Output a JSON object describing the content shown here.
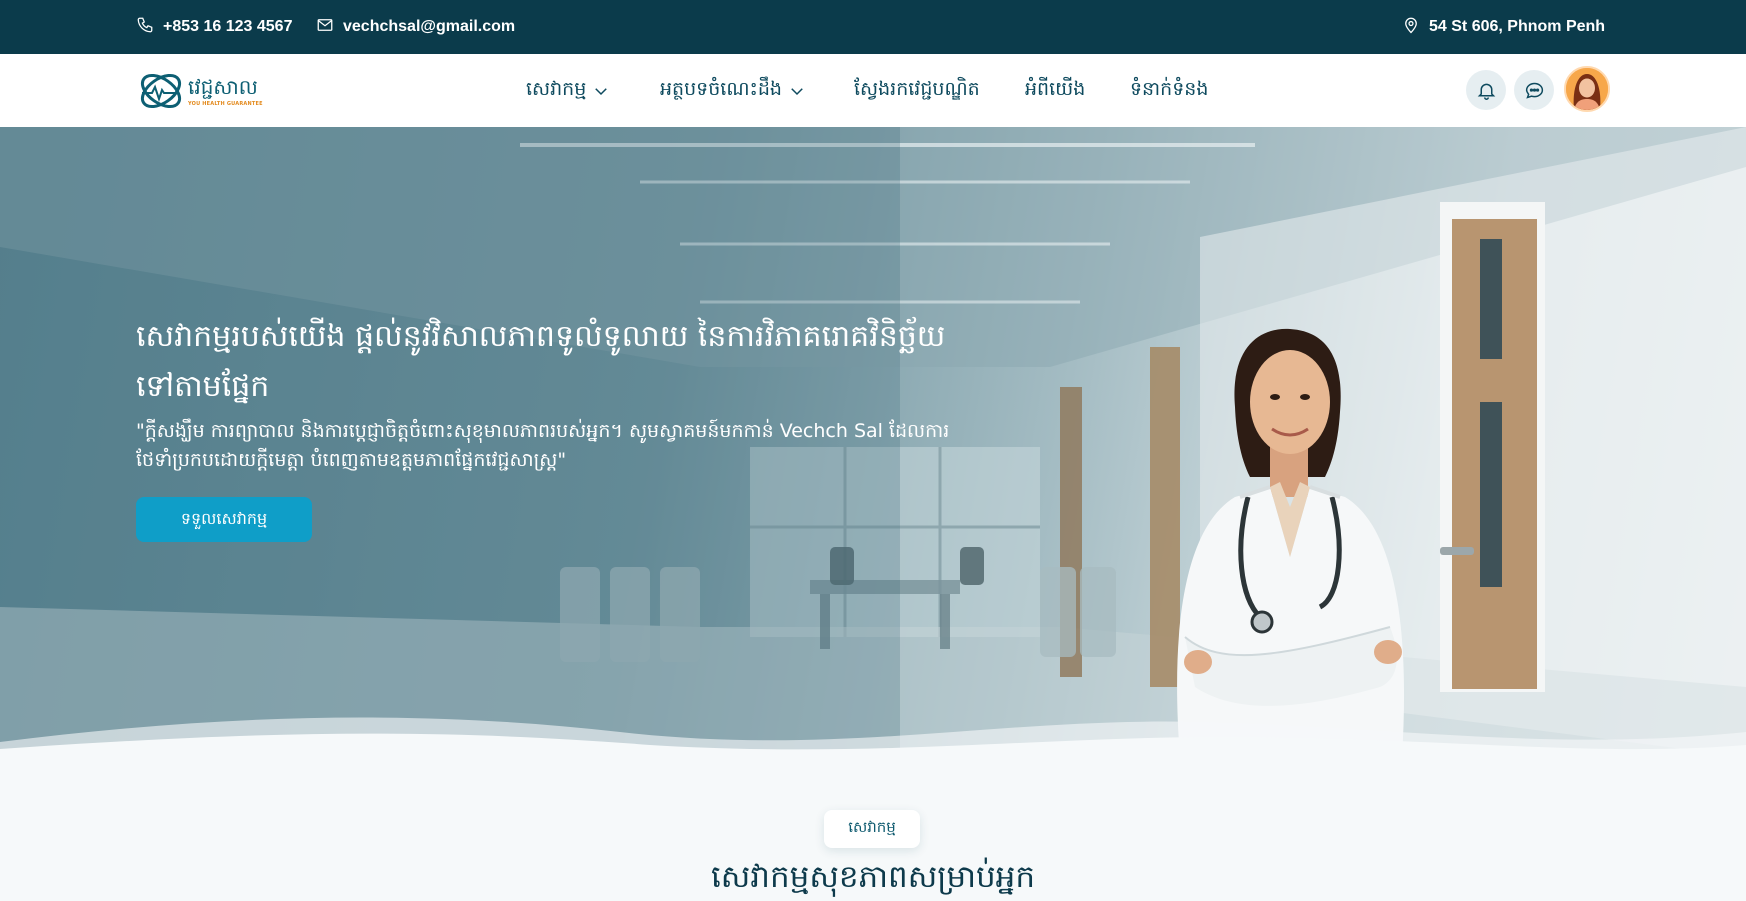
{
  "topbar": {
    "phone": "+853 16 123 4567",
    "email": "vechchsal@gmail.com",
    "address": "54 St 606, Phnom Penh",
    "icons": [
      "phone-icon",
      "mail-icon",
      "location-pin-icon"
    ]
  },
  "logo": {
    "text": "វេជ្ជសាល",
    "subtext": "YOU HEALTH GUARANTEE"
  },
  "nav": {
    "services": "សេវាកម្ម",
    "articles": "អត្ថបទចំណេះដឹង",
    "find_doctor": "ស្វែងរកវេជ្ជបណ្ឌិត",
    "about": "អំពីយើង",
    "contact": "ទំនាក់ទំនង"
  },
  "header_actions": {
    "icons": [
      "bell-icon",
      "chat-icon",
      "avatar"
    ]
  },
  "hero": {
    "title": "សេវាកម្មរបស់យើង ផ្តល់នូវវិសាលភាពទូលំទូលាយ នៃការវិភាគរោគវិនិច្ឆ័យទៅតាមផ្នែក",
    "quote": "\"ក្តីសង្ឃឹម ការព្យាបាល និងការប្តេជ្ញាចិត្តចំពោះសុខុមាលភាពរបស់អ្នក។ សូមស្វាគមន៍មកកាន់ Vechch Sal ដែលការថែទាំប្រកបដោយក្តីមេត្តា បំពេញតាមឧត្តមភាពផ្នែកវេជ្ជសាស្ត្រ\"",
    "cta_label": "ទទួលសេវាកម្ម"
  },
  "services_section": {
    "badge": "សេវាកម្ម",
    "title": "សេវាកម្មសុខភាពសម្រាប់អ្នក"
  },
  "colors": {
    "topbar": "#0b3b4b",
    "accent": "#0f9ec8",
    "nav_text": "#0e4a5e",
    "logo_orange": "#e38a1d"
  }
}
